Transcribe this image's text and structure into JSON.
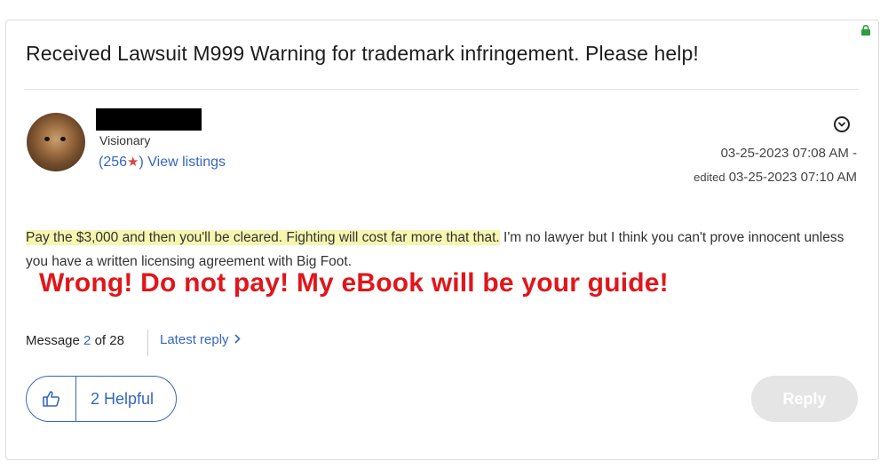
{
  "post": {
    "title": "Received Lawsuit M999 Warning for trademark infringement. Please help!",
    "author": {
      "rank": "Visionary",
      "stats_open": "(",
      "feedback_score": "256",
      "star": "★",
      "stats_close": ")",
      "view_listings": "View listings"
    },
    "posted": "03-25-2023 07:08 AM -",
    "edited_label": "edited",
    "edited": "03-25-2023 07:10 AM",
    "body_highlight": "Pay the $3,000 and then you'll be cleared. Fighting will cost far more that that.",
    "body_rest": " I'm no lawyer but I think  you can't  prove innocent unless you have a written licensing agreement with Big Foot."
  },
  "overlay_text": "Wrong! Do not pay! My eBook will be your guide!",
  "footer": {
    "message_label": "Message",
    "message_current": "2",
    "message_of": "of 28",
    "latest_reply": "Latest reply",
    "helpful": "2 Helpful",
    "reply": "Reply"
  },
  "colors": {
    "link": "#3665c4",
    "highlight": "#f6f6b0",
    "overlay": "#e0161b",
    "lock": "#2e9d3e"
  },
  "icons": [
    "lock-icon",
    "options-icon",
    "star-icon",
    "chevron-right-icon",
    "thumbs-up-icon"
  ]
}
